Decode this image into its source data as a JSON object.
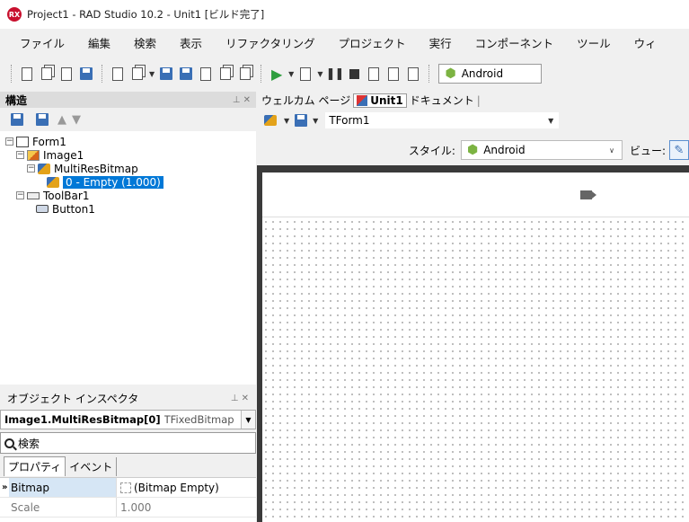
{
  "window": {
    "title": "Project1 - RAD Studio 10.2 - Unit1 [ビルド完了]",
    "logo": "RX"
  },
  "menu": [
    "ファイル",
    "編集",
    "検索",
    "表示",
    "リファクタリング",
    "プロジェクト",
    "実行",
    "コンポーネント",
    "ツール",
    "ウィ"
  ],
  "toolbar": {
    "platform": "Android"
  },
  "structure": {
    "title": "構造",
    "tree": {
      "form": "Form1",
      "image": "Image1",
      "multires": "MultiResBitmap",
      "item": "0 - Empty (1.000)",
      "toolbar": "ToolBar1",
      "button": "Button1"
    }
  },
  "inspector": {
    "title": "オブジェクト インスペクタ",
    "selected_name": "Image1.MultiResBitmap[0]",
    "selected_type": "TFixedBitmap",
    "search": "検索",
    "tabs": [
      "プロパティ",
      "イベント"
    ],
    "properties": [
      {
        "name": "Bitmap",
        "value": "(Bitmap Empty)"
      },
      {
        "name": "Scale",
        "value": "1.000"
      }
    ]
  },
  "editor": {
    "tabs": [
      "ウェルカム ページ",
      "Unit1",
      "ドキュメント"
    ],
    "form_combo": "TForm1",
    "style_label": "スタイル:",
    "style_value": "Android",
    "view_label": "ビュー:"
  },
  "colors": {
    "selection": "#0078d7",
    "android": "#7cb342",
    "run": "#2e9e3e",
    "logo": "#c8102e"
  }
}
